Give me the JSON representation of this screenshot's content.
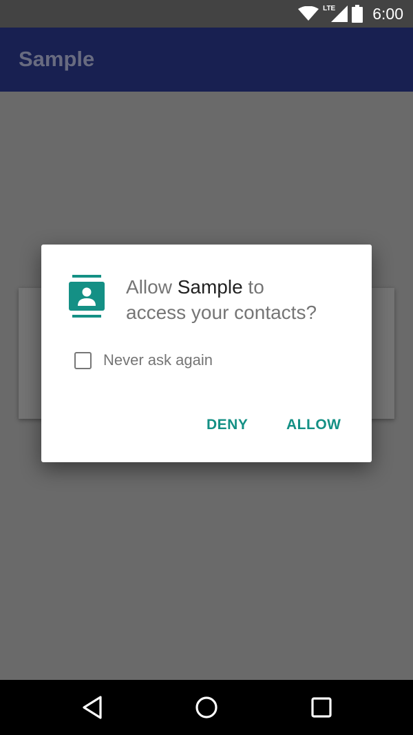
{
  "status_bar": {
    "network": "LTE",
    "time": "6:00"
  },
  "app_bar": {
    "title": "Sample"
  },
  "dialog": {
    "prefix": "Allow ",
    "app_name": "Sample",
    "suffix_line1": " to",
    "line2": "access your contacts?",
    "never_ask_label": "Never ask again",
    "never_ask_checked": false,
    "deny_label": "DENY",
    "allow_label": "ALLOW",
    "icon": "contacts-icon",
    "accent_color": "#149085"
  },
  "nav_bar": {
    "icons": [
      "back-icon",
      "home-icon",
      "recents-icon"
    ]
  }
}
